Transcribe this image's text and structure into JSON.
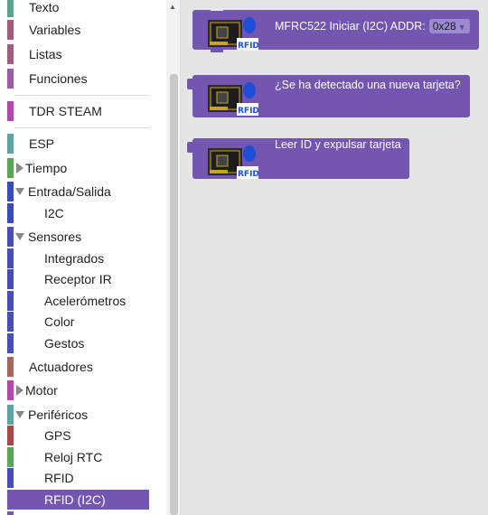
{
  "toolbox": {
    "items": [
      {
        "label": "Texto",
        "color": "#5ba58c"
      },
      {
        "label": "Variables",
        "color": "#a55b80"
      },
      {
        "label": "Listas",
        "color": "#a55b80"
      },
      {
        "label": "Funciones",
        "color": "#9a5ca6"
      },
      {
        "label": "TDR STEAM",
        "color": "#b245b0"
      },
      {
        "label": "ESP",
        "color": "#5ba5a5"
      },
      {
        "label": "Tiempo",
        "color": "#5ba55b"
      },
      {
        "label": "Entrada/Salida",
        "color": "#3a4ab8"
      },
      {
        "label": "I2C",
        "color": "#3a4ab8"
      },
      {
        "label": "Sensores",
        "color": "#4450b8"
      },
      {
        "label": "Integrados",
        "color": "#4450b8"
      },
      {
        "label": "Receptor IR",
        "color": "#4450b8"
      },
      {
        "label": "Acelerómetros",
        "color": "#4450b8"
      },
      {
        "label": "Color",
        "color": "#4450b8"
      },
      {
        "label": "Gestos",
        "color": "#4450b8"
      },
      {
        "label": "Actuadores",
        "color": "#a5675b"
      },
      {
        "label": "Motor",
        "color": "#b245b0"
      },
      {
        "label": "Periféricos",
        "color": "#5ba5a5"
      },
      {
        "label": "GPS",
        "color": "#a54a4a"
      },
      {
        "label": "Reloj RTC",
        "color": "#5ba55b"
      },
      {
        "label": "RFID",
        "color": "#4450b8"
      },
      {
        "label": "RFID (I2C)",
        "color": "#7256b0"
      }
    ]
  },
  "blocks": [
    {
      "text": "MFRC522 Iniciar (I2C)  ADDR:",
      "dropdown_value": "0x28",
      "icon": "rfid-module-icon"
    },
    {
      "text": "¿Se ha detectado una nueva tarjeta?",
      "icon": "rfid-module-icon"
    },
    {
      "text": "Leer ID y expulsar tarjeta",
      "icon": "rfid-module-icon"
    }
  ],
  "icon_label": "RFID",
  "colors": {
    "block": "#7256b0",
    "workspace": "#e5e5e5",
    "selected": "#7256b0"
  }
}
